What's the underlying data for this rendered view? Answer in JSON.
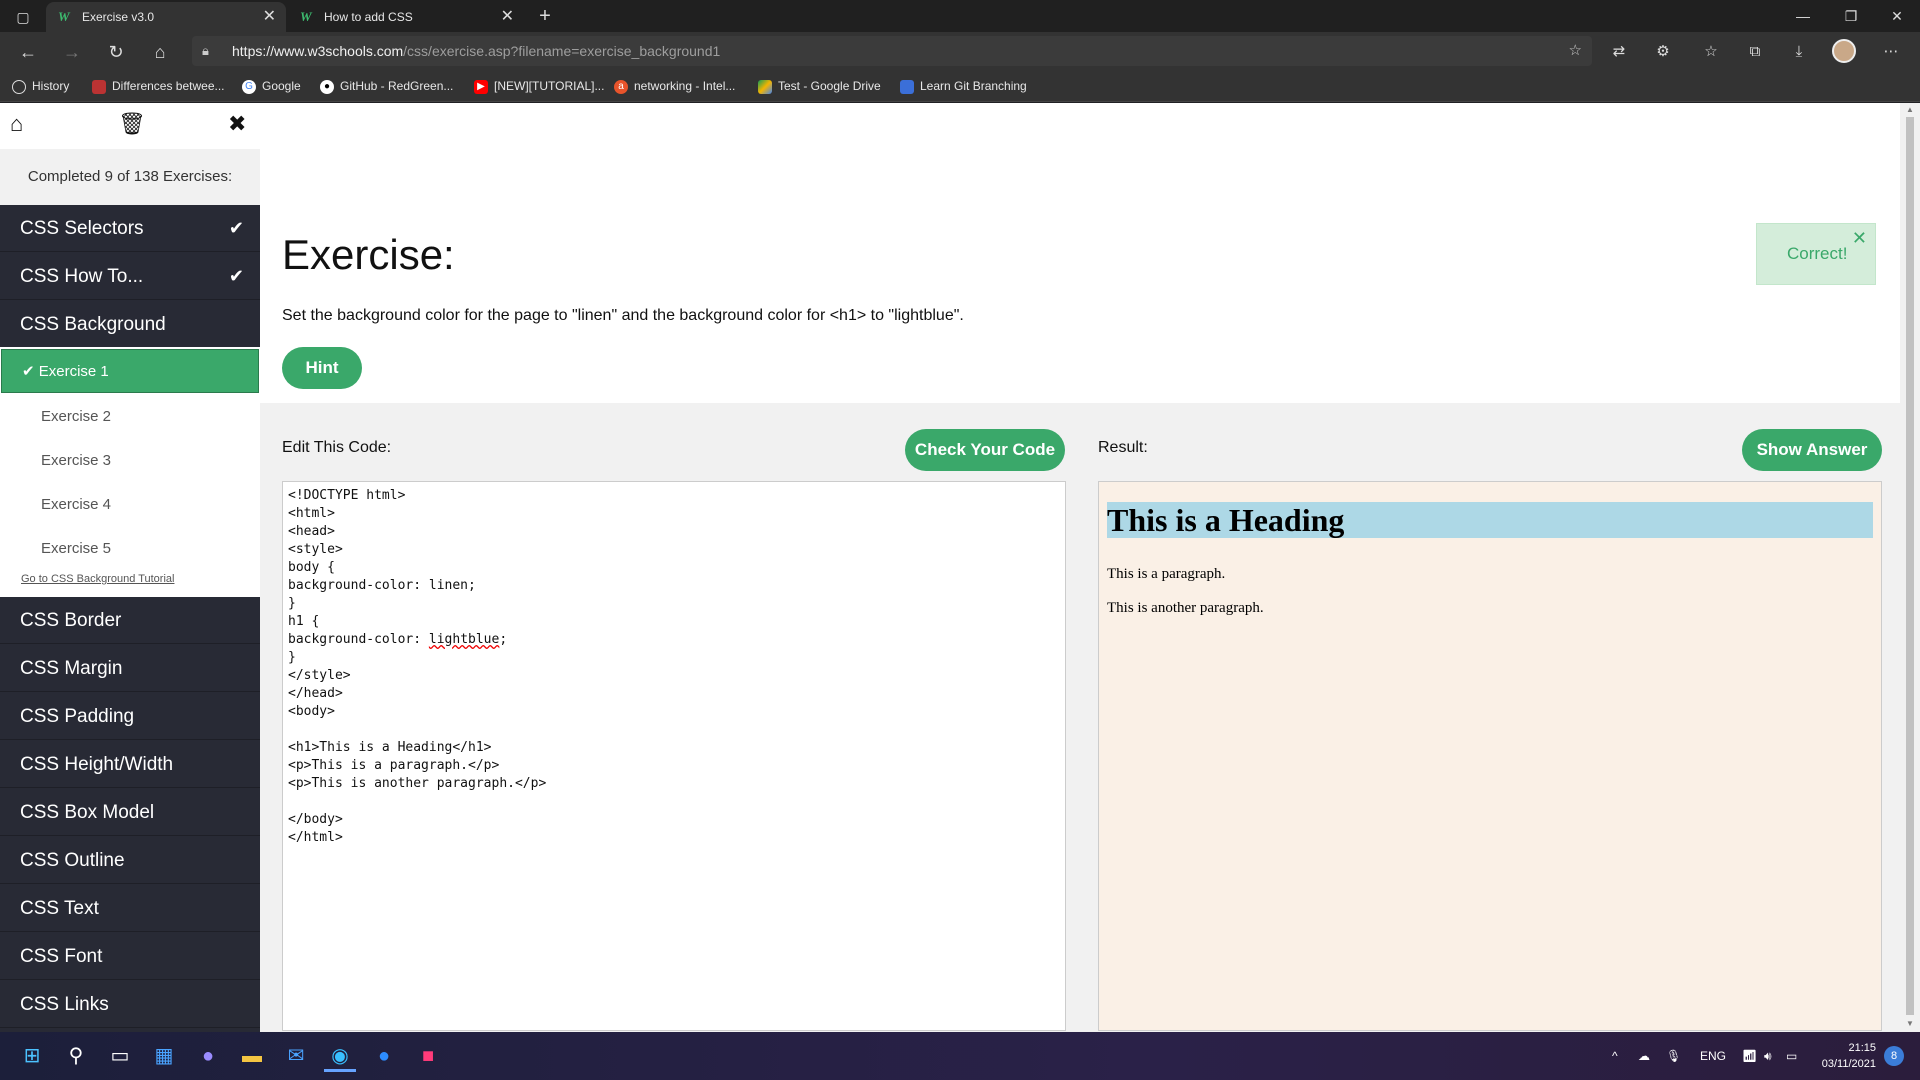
{
  "browser": {
    "tabs": [
      {
        "label": "Exercise v3.0",
        "favicon": "W"
      },
      {
        "label": "How to add CSS",
        "favicon": "W"
      }
    ],
    "url_host": "https://www.w3schools.com",
    "url_path": "/css/exercise.asp?filename=exercise_background1",
    "bookmarks": [
      {
        "label": "History",
        "icon": "history-icon"
      },
      {
        "label": "Differences betwee...",
        "icon": "bookmark-icon"
      },
      {
        "label": "Google",
        "icon": "google-icon"
      },
      {
        "label": "GitHub - RedGreen...",
        "icon": "github-icon"
      },
      {
        "label": "[NEW][TUTORIAL]...",
        "icon": "youtube-icon"
      },
      {
        "label": "networking - Intel...",
        "icon": "ask-icon"
      },
      {
        "label": "Test - Google Drive",
        "icon": "drive-icon"
      },
      {
        "label": "Learn Git Branching",
        "icon": "git-icon"
      }
    ]
  },
  "sidebar": {
    "completed": "Completed 9 of 138 Exercises:",
    "topics_top": [
      {
        "label": "CSS Selectors",
        "done": true
      },
      {
        "label": "CSS How To...",
        "done": true
      },
      {
        "label": "CSS Background",
        "done": false
      }
    ],
    "exercises": [
      {
        "label": "Exercise 1",
        "active": true
      },
      {
        "label": "Exercise 2",
        "active": false
      },
      {
        "label": "Exercise 3",
        "active": false
      },
      {
        "label": "Exercise 4",
        "active": false
      },
      {
        "label": "Exercise 5",
        "active": false
      }
    ],
    "tutorial_link": "Go to CSS Background Tutorial",
    "topics_bottom": [
      {
        "label": "CSS Border"
      },
      {
        "label": "CSS Margin"
      },
      {
        "label": "CSS Padding"
      },
      {
        "label": "CSS Height/Width"
      },
      {
        "label": "CSS Box Model"
      },
      {
        "label": "CSS Outline"
      },
      {
        "label": "CSS Text"
      },
      {
        "label": "CSS Font"
      },
      {
        "label": "CSS Links"
      }
    ]
  },
  "exercise": {
    "title": "Exercise:",
    "description": "Set the background color for the page to \"linen\" and the background color for <h1> to \"lightblue\".",
    "hint_label": "Hint",
    "toast": "Correct!",
    "edit_label": "Edit This Code:",
    "check_label": "Check Your Code",
    "result_label": "Result:",
    "answer_label": "Show Answer",
    "code_before": "<!DOCTYPE html>\n<html>\n<head>\n<style>\nbody {\nbackground-color: linen;\n}\nh1 {\nbackground-color: ",
    "code_highlight": "lightblue",
    "code_after": ";\n}\n</style>\n</head>\n<body>\n\n<h1>This is a Heading</h1>\n<p>This is a paragraph.</p>\n<p>This is another paragraph.</p>\n\n</body>\n</html>",
    "result_heading": "This is a Heading",
    "result_p1": "This is a paragraph.",
    "result_p2": "This is another paragraph.",
    "result_bg": "#faf0e6",
    "heading_bg": "#add8e6",
    "accent": "#3aa86a"
  },
  "taskbar": {
    "lang": "ENG",
    "time": "21:15",
    "date": "03/11/2021",
    "notifications": "8"
  }
}
